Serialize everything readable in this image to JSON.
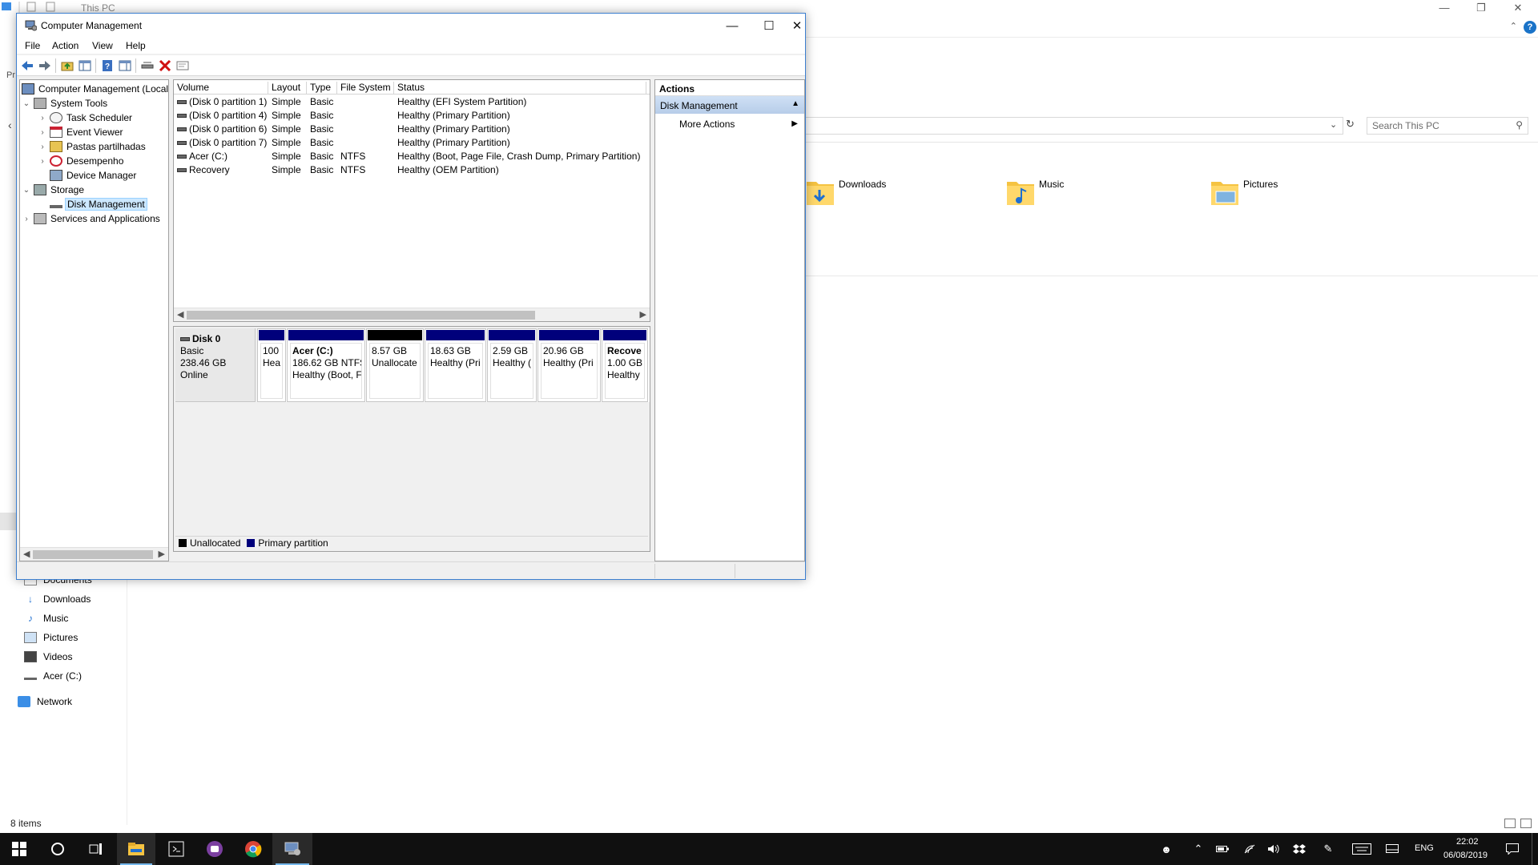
{
  "explorer": {
    "title": "This PC",
    "search_placeholder": "Search This PC",
    "prefix_label": "Pr",
    "folders": [
      {
        "label": "Downloads",
        "icon": "downloads-folder-icon"
      },
      {
        "label": "Music",
        "icon": "music-folder-icon"
      },
      {
        "label": "Pictures",
        "icon": "pictures-folder-icon"
      }
    ],
    "nav": [
      {
        "label": "Documents",
        "icon": "documents-icon"
      },
      {
        "label": "Downloads",
        "icon": "downloads-icon"
      },
      {
        "label": "Music",
        "icon": "music-icon"
      },
      {
        "label": "Pictures",
        "icon": "pictures-icon"
      },
      {
        "label": "Videos",
        "icon": "videos-icon"
      },
      {
        "label": "Acer (C:)",
        "icon": "drive-icon"
      },
      {
        "label": "Network",
        "icon": "network-icon"
      }
    ],
    "status": "8 items"
  },
  "cm": {
    "title": "Computer Management",
    "menu": [
      "File",
      "Action",
      "View",
      "Help"
    ],
    "tree": [
      {
        "label": "Computer Management (Local",
        "expander": "",
        "icon": "computer-management-icon"
      },
      {
        "label": "System Tools",
        "expander": "v",
        "icon": "system-tools-icon"
      },
      {
        "label": "Task Scheduler",
        "expander": ">",
        "icon": "task-scheduler-icon"
      },
      {
        "label": "Event Viewer",
        "expander": ">",
        "icon": "event-viewer-icon"
      },
      {
        "label": "Pastas partilhadas",
        "expander": ">",
        "icon": "shared-folders-icon"
      },
      {
        "label": "Desempenho",
        "expander": ">",
        "icon": "performance-icon"
      },
      {
        "label": "Device Manager",
        "expander": "",
        "icon": "device-manager-icon"
      },
      {
        "label": "Storage",
        "expander": "v",
        "icon": "storage-icon"
      },
      {
        "label": "Disk Management",
        "expander": "",
        "icon": "disk-management-icon"
      },
      {
        "label": "Services and Applications",
        "expander": ">",
        "icon": "services-icon"
      }
    ],
    "columns": [
      "Volume",
      "Layout",
      "Type",
      "File System",
      "Status"
    ],
    "volumes": [
      {
        "volume": "(Disk 0 partition 1)",
        "layout": "Simple",
        "type": "Basic",
        "fs": "",
        "status": "Healthy (EFI System Partition)"
      },
      {
        "volume": "(Disk 0 partition 4)",
        "layout": "Simple",
        "type": "Basic",
        "fs": "",
        "status": "Healthy (Primary Partition)"
      },
      {
        "volume": "(Disk 0 partition 6)",
        "layout": "Simple",
        "type": "Basic",
        "fs": "",
        "status": "Healthy (Primary Partition)"
      },
      {
        "volume": "(Disk 0 partition 7)",
        "layout": "Simple",
        "type": "Basic",
        "fs": "",
        "status": "Healthy (Primary Partition)"
      },
      {
        "volume": "Acer (C:)",
        "layout": "Simple",
        "type": "Basic",
        "fs": "NTFS",
        "status": "Healthy (Boot, Page File, Crash Dump, Primary Partition)"
      },
      {
        "volume": "Recovery",
        "layout": "Simple",
        "type": "Basic",
        "fs": "NTFS",
        "status": "Healthy (OEM Partition)"
      }
    ],
    "disk": {
      "name": "Disk 0",
      "kind": "Basic",
      "size": "238.46 GB",
      "state": "Online"
    },
    "partitions": [
      {
        "title": "",
        "line1": "100",
        "line2": "Hea",
        "bar": "#00007b"
      },
      {
        "title": "Acer  (C:)",
        "line1": "186.62 GB NTFS",
        "line2": "Healthy (Boot, F",
        "bar": "#00007b"
      },
      {
        "title": "",
        "line1": "8.57 GB",
        "line2": "Unallocate",
        "bar": "#000000"
      },
      {
        "title": "",
        "line1": "18.63 GB",
        "line2": "Healthy (Pri",
        "bar": "#00007b"
      },
      {
        "title": "",
        "line1": "2.59 GB",
        "line2": "Healthy (",
        "bar": "#00007b"
      },
      {
        "title": "",
        "line1": "20.96 GB",
        "line2": "Healthy (Pri",
        "bar": "#00007b"
      },
      {
        "title": "Recove",
        "line1": "1.00 GB",
        "line2": "Healthy",
        "bar": "#00007b"
      }
    ],
    "legend": [
      {
        "label": "Unallocated",
        "color": "#000000"
      },
      {
        "label": "Primary partition",
        "color": "#00007b"
      }
    ],
    "actions": {
      "header": "Actions",
      "section": "Disk Management",
      "item": "More Actions"
    }
  },
  "taskbar": {
    "language": "ENG",
    "time": "22:02",
    "date": "06/08/2019"
  }
}
